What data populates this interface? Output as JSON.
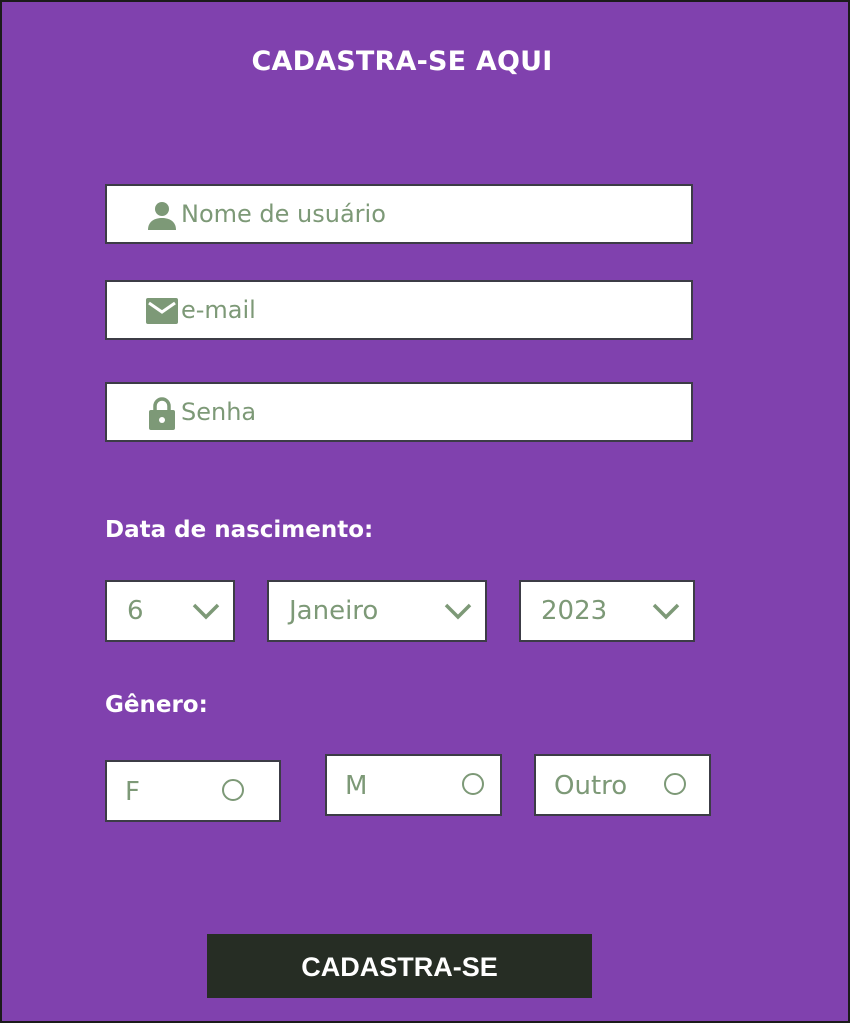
{
  "form": {
    "title": "CADASTRA-SE AQUI",
    "username": {
      "placeholder": "Nome de usuário",
      "icon": "user-icon"
    },
    "email": {
      "placeholder": "e-mail",
      "icon": "mail-icon"
    },
    "password": {
      "placeholder": "Senha",
      "icon": "lock-icon"
    },
    "birth_label": "Data de nascimento:",
    "day": "6",
    "month": "Janeiro",
    "year": "2023",
    "gender_label": "Gênero:",
    "gender_options": [
      "F",
      "M",
      "Outro"
    ],
    "submit_label": "CADASTRA-SE"
  },
  "colors": {
    "background": "#8041ae",
    "field_text": "#7d9977",
    "button": "#262d24"
  }
}
